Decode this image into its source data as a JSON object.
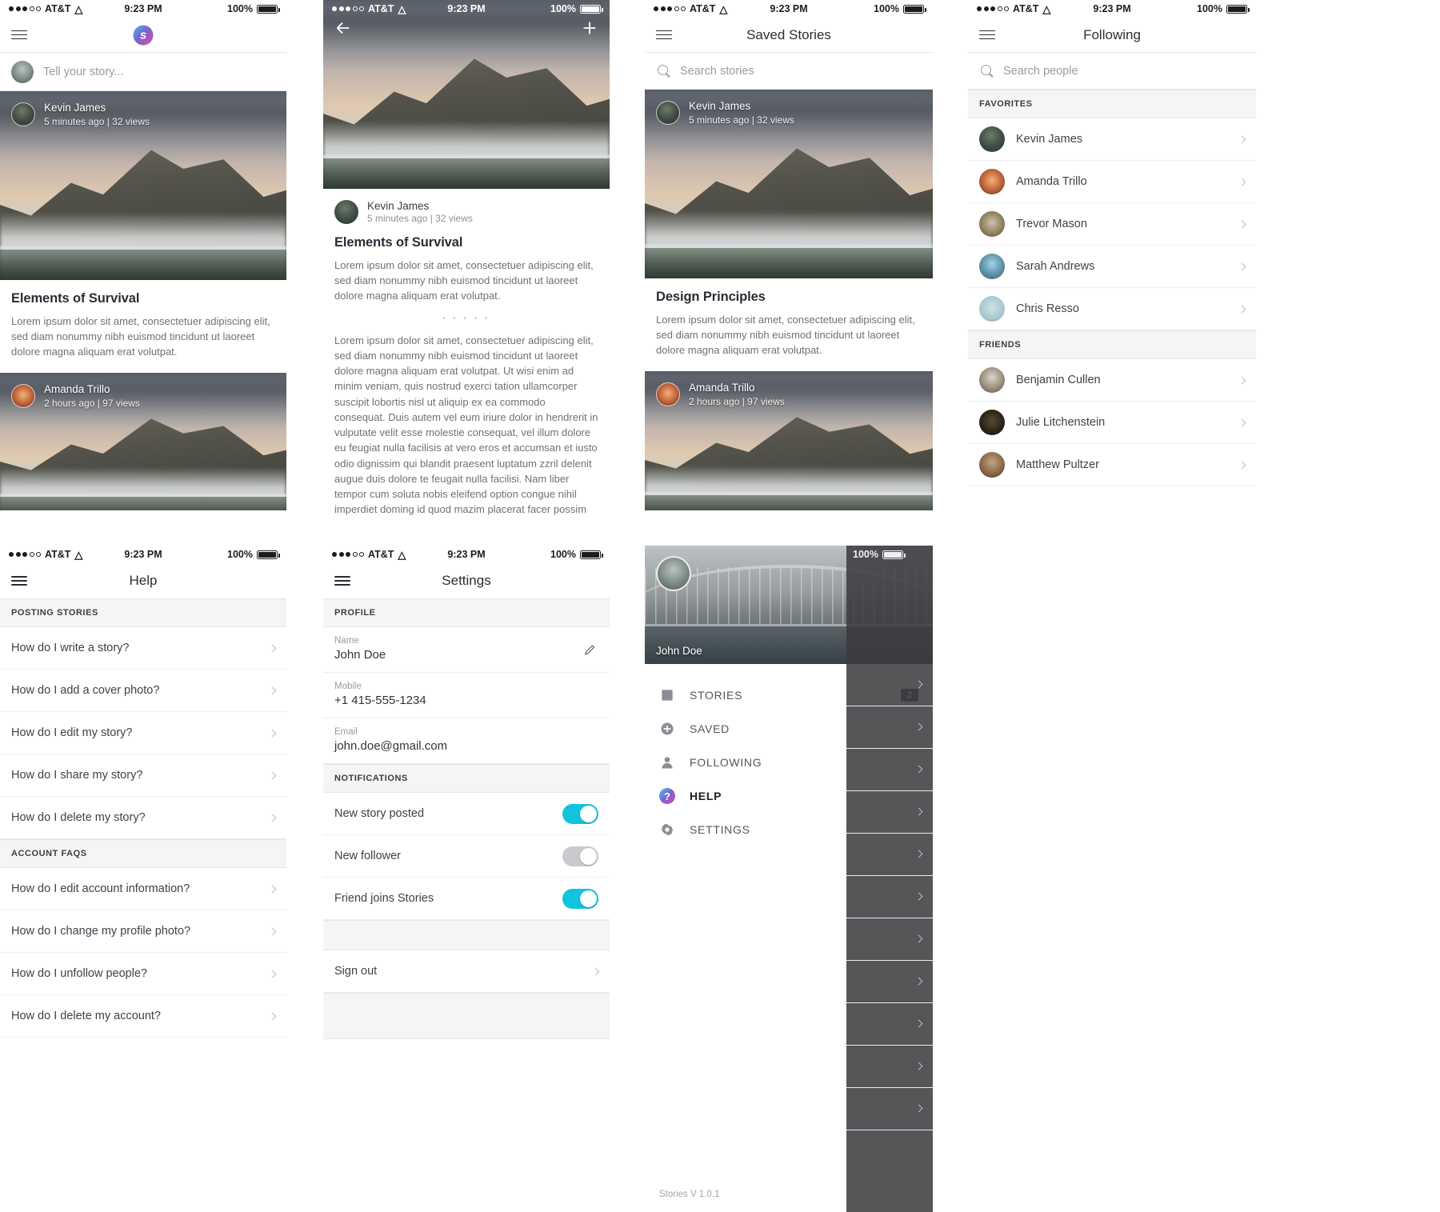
{
  "status_bar": {
    "carrier": "AT&T",
    "time": "9:23 PM",
    "battery": "100%"
  },
  "screens": {
    "feed": {
      "logo": "s",
      "compose_placeholder": "Tell your story...",
      "cards": [
        {
          "author": "Kevin James",
          "meta": "5 minutes ago   |   32 views",
          "title": "Elements of Survival",
          "excerpt": "Lorem ipsum dolor sit amet, consectetuer adipiscing elit, sed diam nonummy nibh euismod tincidunt ut laoreet dolore magna aliquam erat volutpat."
        },
        {
          "author": "Amanda Trillo",
          "meta": "2 hours ago   |   97 views"
        }
      ]
    },
    "detail": {
      "author": "Kevin James",
      "meta": "5 minutes ago   |   32 views",
      "title": "Elements of Survival",
      "lead": "Lorem ipsum dolor sit amet, consectetuer adipiscing elit, sed diam nonummy nibh euismod tincidunt ut laoreet dolore magna aliquam erat volutpat.",
      "divider": "• • • • •",
      "body": "Lorem ipsum dolor sit amet, consectetuer adipiscing elit, sed diam nonummy nibh euismod tincidunt ut laoreet dolore magna aliquam erat volutpat. Ut wisi enim ad minim veniam, quis nostrud exerci tation ullamcorper suscipit lobortis nisl ut aliquip ex ea commodo consequat. Duis autem vel eum iriure dolor in hendrerit in vulputate velit esse molestie consequat, vel illum dolore eu feugiat nulla facilisis at vero eros et accumsan et iusto odio dignissim qui blandit praesent luptatum zzril delenit augue duis dolore te feugait nulla facilisi. Nam liber tempor cum soluta nobis eleifend option congue nihil imperdiet doming id quod mazim placerat facer possim assum. Typi non habent claritatem insitam; est usus legentis in iis qui facit eorum claritatem. Investigationes demonstraverunt lectores legere me lius quod ii legunt saepius."
    },
    "saved": {
      "title": "Saved Stories",
      "search_placeholder": "Search stories",
      "cards": [
        {
          "author": "Kevin James",
          "meta": "5 minutes ago   |   32 views",
          "title": "Design Principles",
          "excerpt": "Lorem ipsum dolor sit amet, consectetuer adipiscing elit, sed diam nonummy nibh euismod tincidunt ut laoreet dolore magna aliquam erat volutpat."
        },
        {
          "author": "Amanda Trillo",
          "meta": "2 hours ago   |   97 views"
        }
      ]
    },
    "following": {
      "title": "Following",
      "search_placeholder": "Search people",
      "sections": [
        {
          "header": "FAVORITES",
          "people": [
            {
              "name": "Kevin James",
              "avatar": "a-kevin"
            },
            {
              "name": "Amanda Trillo",
              "avatar": "a-amanda"
            },
            {
              "name": "Trevor Mason",
              "avatar": "a-trevor"
            },
            {
              "name": "Sarah Andrews",
              "avatar": "a-sarah"
            },
            {
              "name": "Chris Resso",
              "avatar": "a-chris"
            }
          ]
        },
        {
          "header": "FRIENDS",
          "people": [
            {
              "name": "Benjamin Cullen",
              "avatar": "a-benjamin"
            },
            {
              "name": "Julie Litchenstein",
              "avatar": "a-julie"
            },
            {
              "name": "Matthew Pultzer",
              "avatar": "a-matthew"
            }
          ]
        }
      ]
    },
    "help": {
      "title": "Help",
      "sections": [
        {
          "header": "POSTING STORIES",
          "items": [
            "How do I write a story?",
            "How do I add a cover photo?",
            "How do I edit my story?",
            "How do I share my story?",
            "How do I delete my story?"
          ]
        },
        {
          "header": "ACCOUNT FAQS",
          "items": [
            "How do I edit account information?",
            "How do I change my profile photo?",
            "How do I unfollow people?",
            "How do I delete my account?"
          ]
        }
      ]
    },
    "settings": {
      "title": "Settings",
      "profile_header": "PROFILE",
      "fields": [
        {
          "key": "Name",
          "value": "John Doe"
        },
        {
          "key": "Mobile",
          "value": "+1 415-555-1234"
        },
        {
          "key": "Email",
          "value": "john.doe@gmail.com"
        }
      ],
      "notifications_header": "NOTIFICATIONS",
      "toggles": [
        {
          "label": "New story posted",
          "state": "on"
        },
        {
          "label": "New follower",
          "state": "off"
        },
        {
          "label": "Friend joins Stories",
          "state": "on"
        }
      ],
      "sign_out": "Sign out"
    },
    "drawer": {
      "user_name": "John Doe",
      "items": [
        {
          "label": "STORIES",
          "icon": "stories-icon",
          "badge": "2",
          "active": false
        },
        {
          "label": "SAVED",
          "icon": "saved-icon",
          "badge": "",
          "active": false
        },
        {
          "label": "FOLLOWING",
          "icon": "following-icon",
          "badge": "",
          "active": false
        },
        {
          "label": "HELP",
          "icon": "help-icon",
          "badge": "",
          "active": true
        },
        {
          "label": "SETTINGS",
          "icon": "settings-icon",
          "badge": "",
          "active": false
        }
      ],
      "version": "Stories V 1.0.1",
      "battery": "100%"
    }
  },
  "colors": {
    "accent_cyan": "#12c3de",
    "brand_gradient_start": "#45c6e8",
    "brand_gradient_end": "#d94fa0"
  }
}
